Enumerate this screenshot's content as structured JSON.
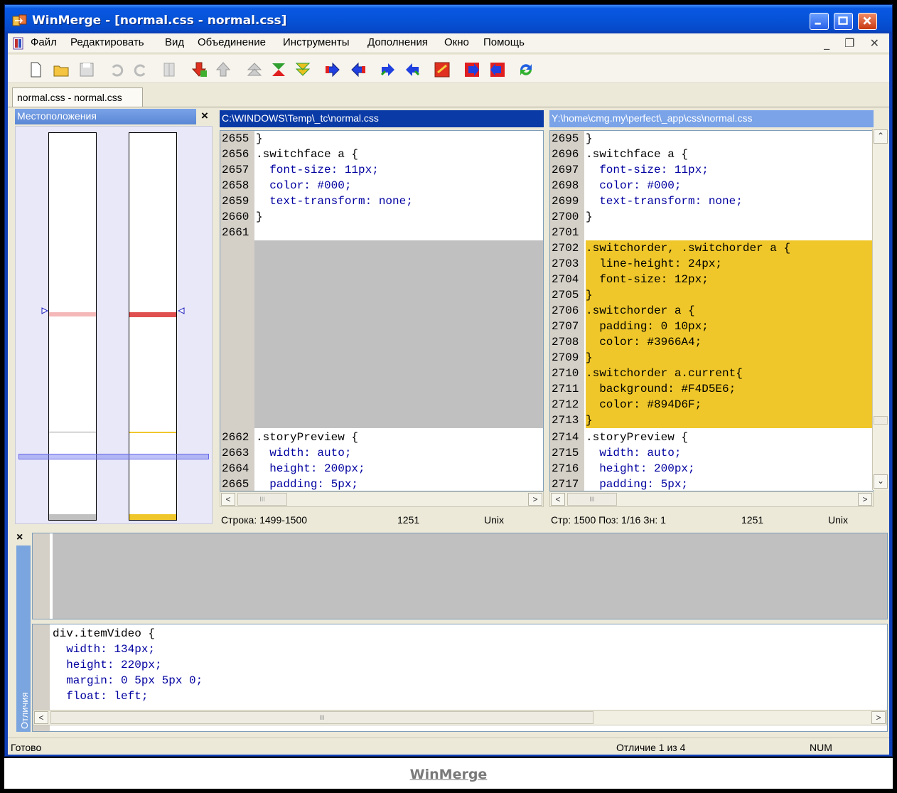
{
  "window": {
    "title": "WinMerge - [normal.css - normal.css]",
    "controls": [
      "minimize",
      "maximize",
      "close"
    ]
  },
  "menu": [
    {
      "label": "Файл"
    },
    {
      "label": "Редактировать"
    },
    {
      "label": "Вид"
    },
    {
      "label": "Объединение"
    },
    {
      "label": "Инструменты"
    },
    {
      "label": "Дополнения"
    },
    {
      "label": "Окно"
    },
    {
      "label": "Помощь"
    }
  ],
  "mdi_controls": "_ ❐ ✕",
  "toolbar": {
    "buttons": [
      "new-icon",
      "open-icon",
      "save-icon",
      "undo-icon",
      "redo-icon",
      "options-icon",
      "next-diff-down-icon",
      "prev-diff-up-icon",
      "first-diff-icon",
      "current-diff-icon",
      "last-diff-icon",
      "copy-right-icon",
      "copy-left-icon",
      "copy-right-advance-icon",
      "copy-left-advance-icon",
      "all-right-icon",
      "all-left-icon",
      "compare-icon",
      "refresh-icon"
    ]
  },
  "tab": {
    "label": "normal.css - normal.css"
  },
  "location_pane": {
    "title": "Местоположения",
    "close": "×"
  },
  "left_pane": {
    "path": "C:\\WINDOWS\\Temp\\_tc\\normal.css",
    "lines_top": [
      {
        "n": "2655",
        "text": "}"
      },
      {
        "n": "2656",
        "text": ".switchface a {"
      },
      {
        "n": "2657",
        "text": "  font-size: 11px;"
      },
      {
        "n": "2658",
        "text": "  color: #000;"
      },
      {
        "n": "2659",
        "text": "  text-transform: none;"
      },
      {
        "n": "2660",
        "text": "}"
      },
      {
        "n": "2661",
        "text": ""
      }
    ],
    "lines_bottom": [
      {
        "n": "2662",
        "text": ".storyPreview {"
      },
      {
        "n": "2663",
        "text": "  width: auto;"
      },
      {
        "n": "2664",
        "text": "  height: 200px;"
      },
      {
        "n": "2665",
        "text": "  padding: 5px;"
      }
    ],
    "status": {
      "line": "Строка: 1499-1500",
      "count": "1251",
      "eol": "Unix"
    }
  },
  "right_pane": {
    "path": "Y:\\home\\cmg.my\\perfect\\_app\\css\\normal.css",
    "lines": [
      {
        "n": "2695",
        "text": "}"
      },
      {
        "n": "2696",
        "text": ".switchface a {"
      },
      {
        "n": "2697",
        "text": "  font-size: 11px;"
      },
      {
        "n": "2698",
        "text": "  color: #000;"
      },
      {
        "n": "2699",
        "text": "  text-transform: none;"
      },
      {
        "n": "2700",
        "text": "}"
      },
      {
        "n": "2701",
        "text": ""
      },
      {
        "n": "2702",
        "text": ".switchorder, .switchorder a {"
      },
      {
        "n": "2703",
        "text": "  line-height: 24px;"
      },
      {
        "n": "2704",
        "text": "  font-size: 12px;"
      },
      {
        "n": "2705",
        "text": "}"
      },
      {
        "n": "2706",
        "text": ".switchorder a {"
      },
      {
        "n": "2707",
        "text": "  padding: 0 10px;"
      },
      {
        "n": "2708",
        "text": "  color: #3966A4;"
      },
      {
        "n": "2709",
        "text": "}"
      },
      {
        "n": "2710",
        "text": ".switchorder a.current{"
      },
      {
        "n": "2711",
        "text": "  background: #F4D5E6;"
      },
      {
        "n": "2712",
        "text": "  color: #894D6F;"
      },
      {
        "n": "2713",
        "text": "}"
      },
      {
        "n": "2714",
        "text": ".storyPreview {"
      },
      {
        "n": "2715",
        "text": "  width: auto;"
      },
      {
        "n": "2716",
        "text": "  height: 200px;"
      },
      {
        "n": "2717",
        "text": "  padding: 5px;"
      }
    ],
    "status": {
      "pos": "Стр: 1500  Поз: 1/16  Зн: 1",
      "count": "1251",
      "eol": "Unix"
    }
  },
  "diff_pane": {
    "close": "×",
    "tab_label": "Отличия",
    "lines": [
      {
        "text": "div.itemVideo {"
      },
      {
        "text": "  width: 134px;"
      },
      {
        "text": "  height: 220px;"
      },
      {
        "text": "  margin: 0 5px 5px 0;"
      },
      {
        "text": "  float: left;"
      }
    ]
  },
  "statusbar": {
    "ready": "Готово",
    "diff": "Отличие 1 из 4",
    "num": "NUM"
  },
  "caption": "WinMerge",
  "colors": {
    "title_blue": "#0653d8",
    "diff_yellow": "#efc72a",
    "blank_gray": "#c0c0c0",
    "css_property": "#0000a0",
    "css_value": "#800000"
  }
}
